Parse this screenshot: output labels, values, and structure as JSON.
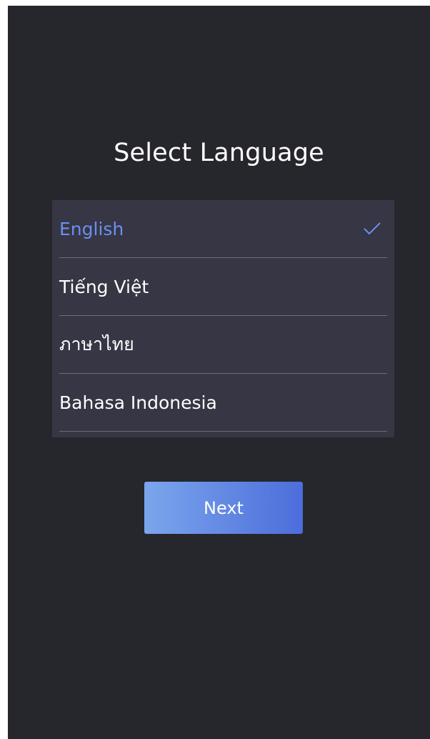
{
  "title": "Select Language",
  "languages": [
    {
      "label": "English",
      "selected": true
    },
    {
      "label": "Tiếng Việt",
      "selected": false
    },
    {
      "label": "ภาษาไทย",
      "selected": false
    },
    {
      "label": "Bahasa Indonesia",
      "selected": false
    }
  ],
  "selected_icon": "check-icon",
  "next_label": "Next",
  "colors": {
    "background": "#26262d",
    "list_background": "#363645",
    "accent": "#6c8fee",
    "button_gradient_start": "#7ba6ec",
    "button_gradient_end": "#4c6ddb"
  }
}
